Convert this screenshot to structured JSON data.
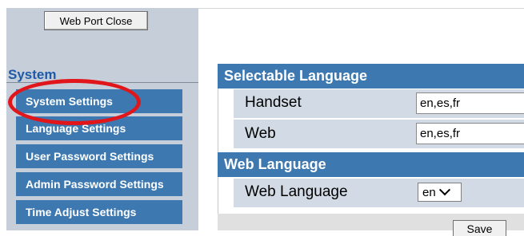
{
  "sidebar": {
    "close_button": "Web Port Close",
    "section_heading": "System",
    "items": [
      {
        "label": "System Settings"
      },
      {
        "label": "Language Settings"
      },
      {
        "label": "User Password Settings"
      },
      {
        "label": "Admin Password Settings"
      },
      {
        "label": "Time Adjust Settings"
      }
    ]
  },
  "selectable_language": {
    "header": "Selectable Language",
    "rows": [
      {
        "label": "Handset",
        "value": "en,es,fr"
      },
      {
        "label": "Web",
        "value": "en,es,fr"
      }
    ]
  },
  "web_language": {
    "header": "Web Language",
    "label": "Web Language",
    "selected": "en"
  },
  "footer": {
    "save_label": "Save"
  },
  "colors": {
    "menu_blue": "#3d79b0",
    "sidebar_bg": "#c6cfd9",
    "row_bg": "#d2dbe5",
    "highlight": "#e0161b"
  }
}
